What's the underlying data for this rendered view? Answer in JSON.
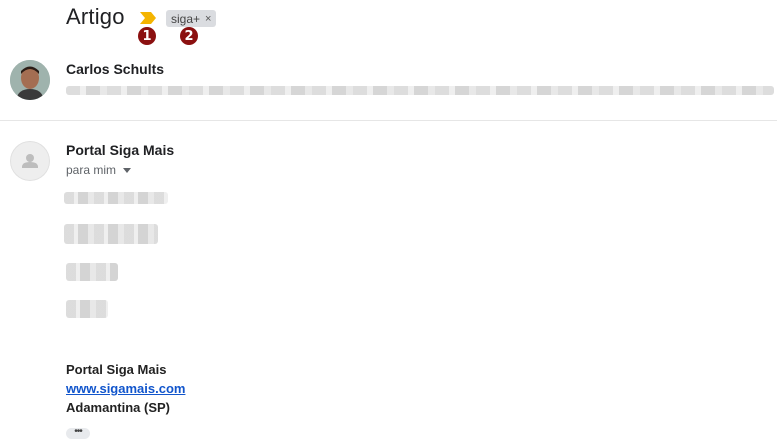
{
  "subject": "Artigo",
  "label_chip": {
    "text": "siga+",
    "remove": "×"
  },
  "callouts": [
    "1",
    "2"
  ],
  "colors": {
    "importance_marker": "#f4b400",
    "callout": "#8b1010",
    "link": "#1155cc"
  },
  "icons": {
    "importance": "importance-marker-icon",
    "caret": "chevron-down-icon",
    "default_avatar": "person-icon"
  },
  "messages": [
    {
      "sender": "Carlos Schults"
    },
    {
      "sender": "Portal Siga Mais",
      "recipient": "para mim"
    }
  ],
  "signature": {
    "name": "Portal Siga Mais",
    "website": "www.sigamais.com",
    "city": "Adamantina (SP)"
  },
  "more_button": "•••"
}
